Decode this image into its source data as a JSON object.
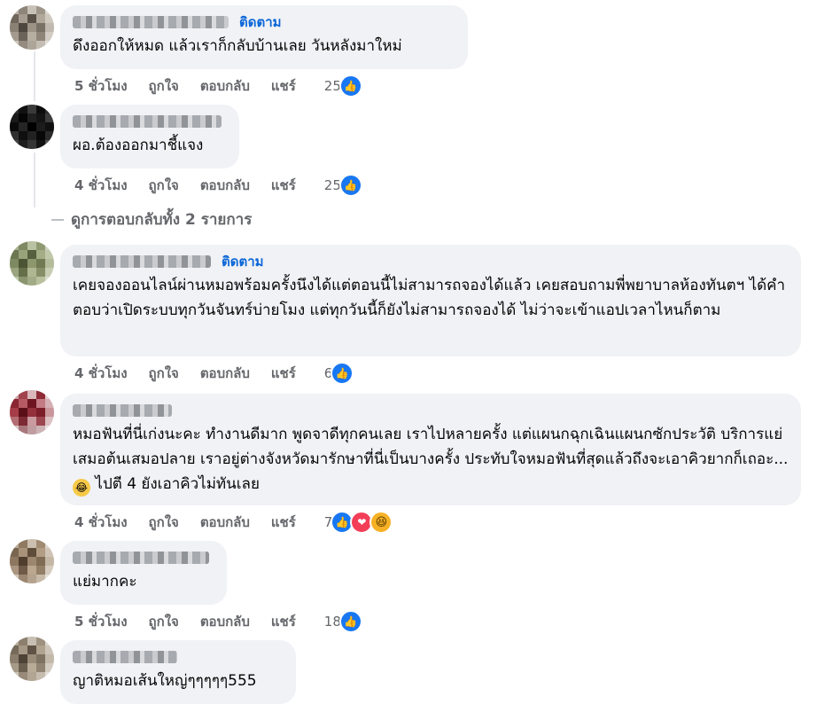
{
  "follow_label": "ติดตาม",
  "more_replies": "ดูการตอบกลับทั้ง 2 รายการ",
  "actions": {
    "like": "ถูกใจ",
    "reply": "ตอบกลับ",
    "share": "แชร์"
  },
  "comments": [
    {
      "text": "ดึงออกให้หมด แล้วเราก็กลับบ้านเลย วันหลังมาใหม่",
      "time": "5 ชั่วโมง",
      "count": "25",
      "reactions": [
        "like"
      ]
    },
    {
      "text": "ผอ.ต้องออกมาชี้แจง",
      "time": "4 ชั่วโมง",
      "count": "25",
      "reactions": [
        "like"
      ]
    },
    {
      "text": "เคยจองออนไลน์ผ่านหมอพร้อมครั้งนึงได้แต่ตอนนี้ไม่สามารถจองได้แล้ว เคยสอบถามพี่พยาบาลห้องทันตฯ ได้คำตอบว่าเปิดระบบทุกวันจันทร์บ่ายโมง แต่ทุกวันนี้ก็ยังไม่สามารถจองได้ ไม่ว่าจะเข้าแอปเวลาไหนก็ตาม",
      "time": "4 ชั่วโมง",
      "count": "6",
      "reactions": [
        "like"
      ]
    },
    {
      "text_before": "หมอฟันที่นี่เก่งนะคะ ทำงานดีมาก พูดจาดีทุกคนเลย เราไปหลายครั้ง แต่แผนกฉุกเฉินแผนกซักประวัติ บริการแย่เสมอต้นเสมอปลาย เราอยู่ต่างจังหวัดมารักษาที่นี่เป็นบางครั้ง ประทับใจหมอฟันที่สุดแล้วถึงจะเอาคิวยากก็เถอะ...",
      "text_after": " ไปตี 4 ยังเอาคิวไม่ทันเลย",
      "time": "4 ชั่วโมง",
      "count": "7",
      "reactions": [
        "like",
        "love",
        "haha"
      ]
    },
    {
      "text": "แย่มากคะ",
      "time": "5 ชั่วโมง",
      "count": "18",
      "reactions": [
        "like"
      ]
    },
    {
      "text": "ญาติหมอเส้นใหญ่ๆๆๆๆๆ555"
    }
  ]
}
